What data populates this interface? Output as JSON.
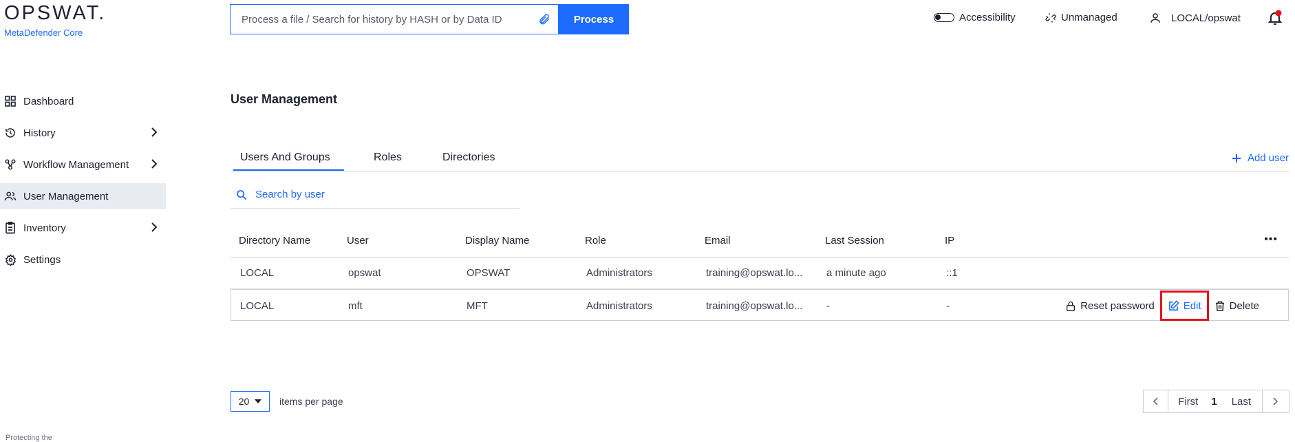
{
  "brand": {
    "logo": "OPSWAT.",
    "product": "MetaDefender Core",
    "tagline": "Protecting the"
  },
  "header": {
    "search_placeholder": "Process a file / Search for history by HASH or by Data ID",
    "process_label": "Process",
    "accessibility_label": "Accessibility",
    "unmanaged_label": "Unmanaged",
    "user_label": "LOCAL/opswat"
  },
  "sidebar": {
    "items": [
      {
        "label": "Dashboard",
        "icon": "grid-icon"
      },
      {
        "label": "History",
        "icon": "history-icon"
      },
      {
        "label": "Workflow Management",
        "icon": "workflow-icon"
      },
      {
        "label": "User Management",
        "icon": "users-icon"
      },
      {
        "label": "Inventory",
        "icon": "clipboard-icon"
      },
      {
        "label": "Settings",
        "icon": "gear-icon"
      }
    ]
  },
  "main": {
    "title": "User Management",
    "tabs": [
      {
        "label": "Users And Groups"
      },
      {
        "label": "Roles"
      },
      {
        "label": "Directories"
      }
    ],
    "add_user_label": "Add user",
    "search_placeholder": "Search by user",
    "table": {
      "columns": [
        "Directory Name",
        "User",
        "Display Name",
        "Role",
        "Email",
        "Last Session",
        "IP"
      ],
      "rows": [
        [
          "LOCAL",
          "opswat",
          "OPSWAT",
          "Administrators",
          "training@opswat.lo...",
          "a minute ago",
          "::1"
        ],
        [
          "LOCAL",
          "mft",
          "MFT",
          "Administrators",
          "training@opswat.lo...",
          "-",
          "-"
        ]
      ],
      "row_actions": {
        "reset_password": "Reset password",
        "edit": "Edit",
        "delete": "Delete"
      }
    },
    "pagination": {
      "per_page_value": "20",
      "per_page_label": "items per page",
      "first": "First",
      "current_page": "1",
      "last": "Last"
    }
  },
  "colors": {
    "accent": "#1d6bff",
    "highlight": "#e0131f",
    "notification": "#e0131f"
  }
}
